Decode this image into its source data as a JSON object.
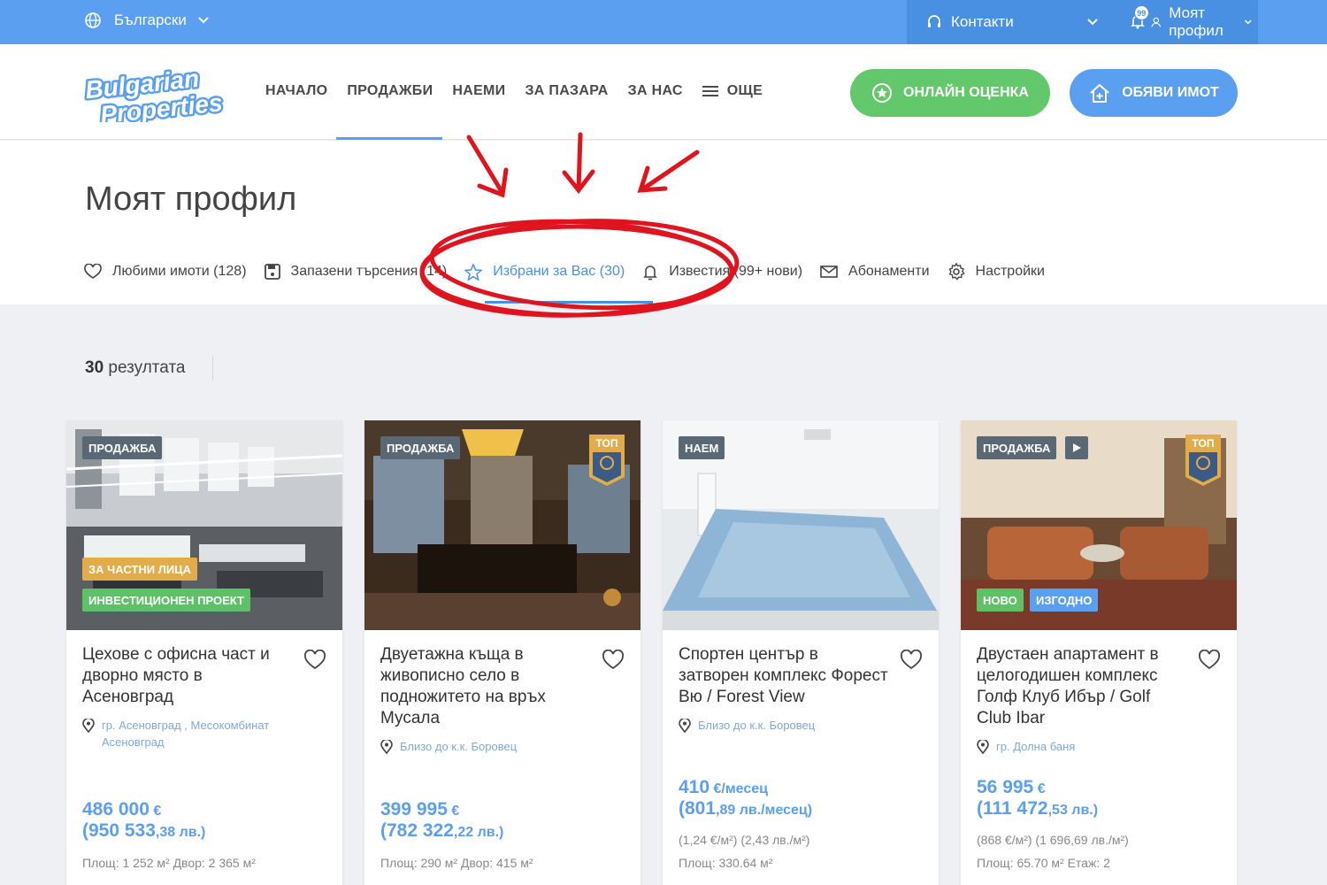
{
  "topbar": {
    "language": "Български",
    "contacts": "Контакти",
    "notifications_count": "99",
    "profile": "Моят профил"
  },
  "header": {
    "logo_text_1": "Bulgarian",
    "logo_text_2": "Properties",
    "nav": [
      "НАЧАЛО",
      "ПРОДАЖБИ",
      "НАЕМИ",
      "ЗА ПАЗАРА",
      "ЗА НАС",
      "ОЩЕ"
    ],
    "btn_valuation": "ОНЛАЙН ОЦЕНКА",
    "btn_list": "ОБЯВИ ИМОТ"
  },
  "profile_page": {
    "title": "Моят профил",
    "tabs": [
      "Любими имоти (128)",
      "Запазени търсения (14)",
      "Избрани за Вас (30)",
      "Известия (99+ нови)",
      "Абонаменти",
      "Настройки"
    ],
    "active_tab": "Избрани за Вас (30)"
  },
  "results": {
    "count": "30",
    "label": "резултата"
  },
  "colors": {
    "accent": "#5b9ff0",
    "green": "#63c86b",
    "annotation": "#e0141e"
  },
  "cards": [
    {
      "deal": "ПРОДАЖБА",
      "tags": [
        "ЗА ЧАСТНИ ЛИЦА",
        "ИНВЕСТИЦИОНЕН ПРОЕКТ"
      ],
      "title": "Цехове с офисна част и дворно място в Асеновград",
      "location": "гр. Асеновград , Месокомбинат Асеновград",
      "price_main": "486 000",
      "price_currency": "€",
      "price_bgn_int": "(950 533",
      "price_bgn_dec": ",38 лв.)",
      "meta": "Площ: 1 252 м² Двор: 2 365 м²"
    },
    {
      "deal": "ПРОДАЖБА",
      "top": "ТОП",
      "title": "Двуетажна къща в живописно село в подножитето на връх Мусала",
      "location": "Близо до к.к. Боровец",
      "price_main": "399 995",
      "price_currency": "€",
      "price_bgn_int": "(782 322",
      "price_bgn_dec": ",22 лв.)",
      "meta": "Площ: 290 м² Двор: 415 м²"
    },
    {
      "deal": "НАЕМ",
      "title": "Спортен център в затворен комплекс Форест Вю / Forest View",
      "location": "Близо до к.к. Боровец",
      "price_main": "410",
      "price_currency": "€/месец",
      "price_bgn_int": "(801",
      "price_bgn_dec": ",89 лв./месец)",
      "per_m2": "(1,24 €/м²) (2,43 лв./м²)",
      "meta": "Площ: 330.64 м²"
    },
    {
      "deal": "ПРОДАЖБА",
      "top": "ТОП",
      "tags": [
        "НОВО",
        "ИЗГОДНО"
      ],
      "title": "Двустаен апартамент в целогодишен комплекс Голф Клуб Ибър / Golf Club Ibar",
      "location": "гр. Долна баня",
      "price_main": "56 995",
      "price_currency": "€",
      "price_bgn_int": "(111 472",
      "price_bgn_dec": ",53 лв.)",
      "per_m2": "(868 €/м²) (1 696,69 лв./м²)",
      "meta": "Площ: 65.70 м² Етаж: 2"
    }
  ]
}
